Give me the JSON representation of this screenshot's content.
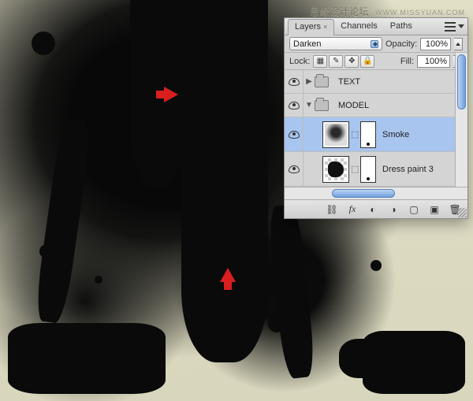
{
  "watermark": {
    "main": "思缘设计论坛",
    "sub": "WWW.MISSYUAN.COM"
  },
  "panel": {
    "tabs": {
      "layers": "Layers",
      "channels": "Channels",
      "paths": "Paths"
    },
    "blend_label": "",
    "blend_mode": "Darken",
    "opacity_label": "Opacity:",
    "opacity_value": "100%",
    "lock_label": "Lock:",
    "fill_label": "Fill:",
    "fill_value": "100%",
    "layers": {
      "group_text": "TEXT",
      "group_model": "MODEL",
      "smoke": "Smoke",
      "dress_paint": "Dress paint 3"
    },
    "icons": {
      "menu": "panel-menu-icon",
      "eye": "visibility-eye-icon",
      "lock_trans": "lock-transparency-icon",
      "lock_paint": "lock-paint-icon",
      "lock_pos": "lock-position-icon",
      "lock_all": "lock-all-icon",
      "fx": "fx",
      "mask": "mask-icon",
      "adjust": "adjustment-icon",
      "group": "group-icon",
      "new": "new-layer-icon",
      "trash": "trash-icon",
      "link": "link-icon"
    }
  }
}
